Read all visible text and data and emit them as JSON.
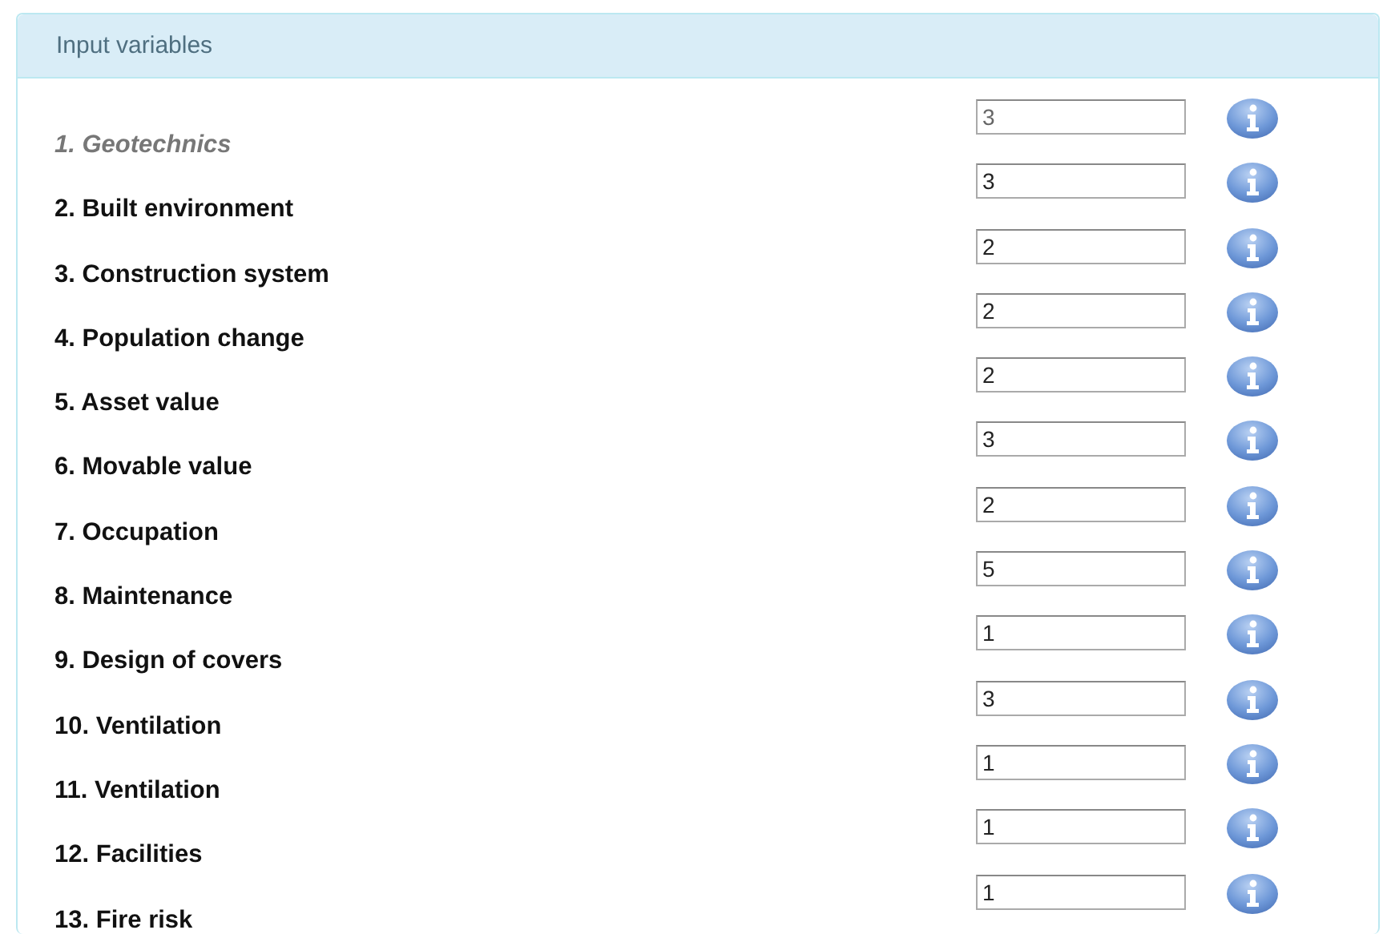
{
  "panel": {
    "title": "Input variables"
  },
  "variables": [
    {
      "label": "1. Geotechnics",
      "value": "3",
      "disabled": true
    },
    {
      "label": "2. Built environment",
      "value": "3",
      "disabled": false
    },
    {
      "label": "3. Construction system",
      "value": "2",
      "disabled": false
    },
    {
      "label": "4. Population change",
      "value": "2",
      "disabled": false
    },
    {
      "label": "5. Asset value",
      "value": "2",
      "disabled": false
    },
    {
      "label": "6. Movable value",
      "value": "3",
      "disabled": false
    },
    {
      "label": "7. Occupation",
      "value": "2",
      "disabled": false
    },
    {
      "label": "8. Maintenance",
      "value": "5",
      "disabled": false
    },
    {
      "label": "9. Design of covers",
      "value": "1",
      "disabled": false
    },
    {
      "label": "10. Ventilation",
      "value": "3",
      "disabled": false
    },
    {
      "label": "11. Ventilation",
      "value": "1",
      "disabled": false
    },
    {
      "label": "12. Facilities",
      "value": "1",
      "disabled": false
    },
    {
      "label": "13. Fire risk",
      "value": "1",
      "disabled": false
    }
  ]
}
